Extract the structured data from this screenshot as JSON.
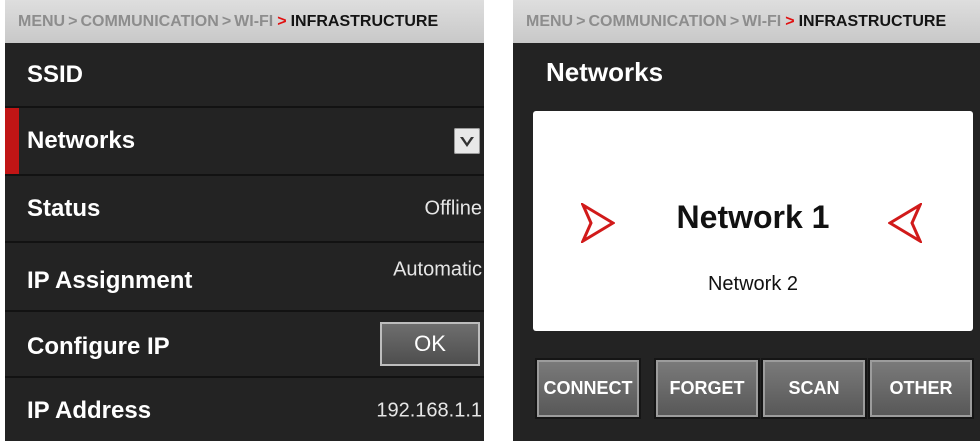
{
  "left_panel": {
    "breadcrumb": {
      "items": [
        "MENU",
        "COMMUNICATION",
        "WI-FI"
      ],
      "current": "INFRASTRUCTURE",
      "separator": ">"
    },
    "rows": [
      {
        "label": "SSID"
      },
      {
        "label": "Networks",
        "control": "dropdown",
        "selected": true
      },
      {
        "label": "Status",
        "value": "Offline"
      },
      {
        "label": "IP Assignment",
        "value": "Automatic"
      },
      {
        "label": "Configure IP",
        "button": "OK"
      },
      {
        "label": "IP Address",
        "value": "192.168.1.1"
      }
    ],
    "icons": {
      "dropdown": "chevron-down-icon"
    }
  },
  "right_panel": {
    "breadcrumb": {
      "items": [
        "MENU",
        "COMMUNICATION",
        "WI-FI"
      ],
      "current": "INFRASTRUCTURE",
      "separator": ">"
    },
    "title": "Networks",
    "networks": {
      "selected": "Network 1",
      "other": "Network 2"
    },
    "icons": {
      "left_arrow": "arrow-right-icon",
      "right_arrow": "arrow-left-icon"
    },
    "buttons": [
      "CONNECT",
      "FORGET",
      "SCAN",
      "OTHER"
    ]
  },
  "colors": {
    "accent": "#c11515",
    "panel_bg": "#232323",
    "breadcrumb_bg": "#d4d4d4",
    "separator_red": "#e01010"
  }
}
